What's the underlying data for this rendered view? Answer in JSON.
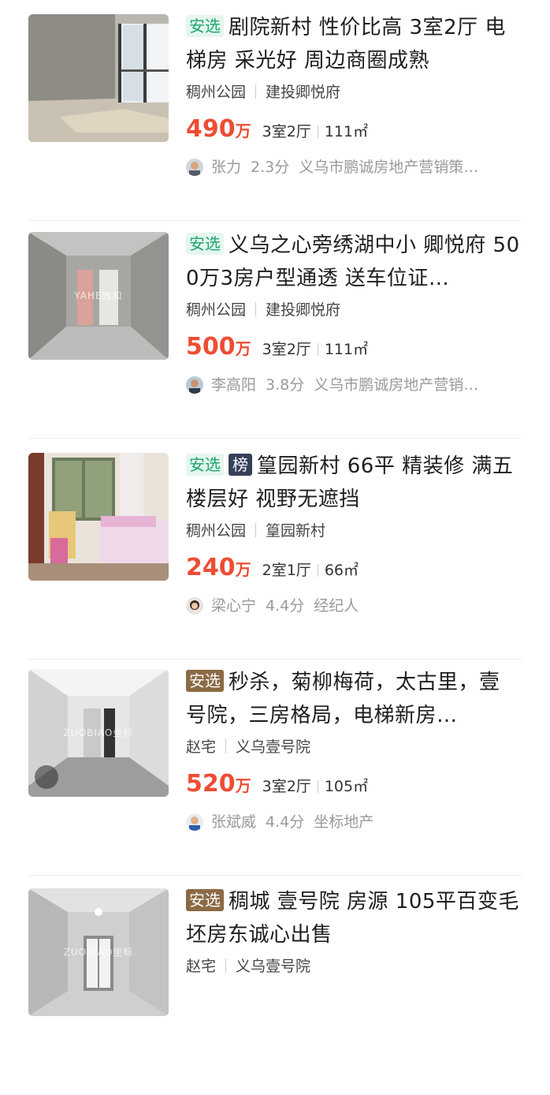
{
  "listings": [
    {
      "tags": [
        {
          "text": "安选",
          "style": "anxuan-green"
        }
      ],
      "title": "剧院新村 性价比高 3室2厅 电梯房 采光好 周边商圈成熟",
      "district": "稠州公园",
      "community": "建投卿悦府",
      "price": "490",
      "price_unit": "万",
      "layout": "3室2厅",
      "area": "111㎡",
      "agent": "张力",
      "score": "2.3分",
      "company": "义乌市鹏诚房地产营销策…",
      "image": "room-balcony"
    },
    {
      "tags": [
        {
          "text": "安选",
          "style": "anxuan-green"
        }
      ],
      "title": "义乌之心旁绣湖中小 卿悦府 500万3房户型通透 送车位证…",
      "district": "稠州公园",
      "community": "建投卿悦府",
      "price": "500",
      "price_unit": "万",
      "layout": "3室2厅",
      "area": "111㎡",
      "agent": "李高阳",
      "score": "3.8分",
      "company": "义乌市鹏诚房地产营销…",
      "image": "room-corridor",
      "watermark": "YAHE雅和"
    },
    {
      "tags": [
        {
          "text": "安选",
          "style": "anxuan-green"
        },
        {
          "text": "榜",
          "style": "bang"
        }
      ],
      "title": "篁园新村 66平 精装修 满五 楼层好 视野无遮挡",
      "district": "稠州公园",
      "community": "篁园新村",
      "price": "240",
      "price_unit": "万",
      "layout": "2室1厅",
      "area": "66㎡",
      "agent": "梁心宁",
      "score": "4.4分",
      "company": "经纪人",
      "image": "room-bedroom"
    },
    {
      "tags": [
        {
          "text": "安选",
          "style": "anxuan-brown"
        }
      ],
      "title": "秒杀，菊柳梅荷，太古里，壹号院，三房格局，电梯新房…",
      "district": "赵宅",
      "community": "义乌壹号院",
      "price": "520",
      "price_unit": "万",
      "layout": "3室2厅",
      "area": "105㎡",
      "agent": "张斌威",
      "score": "4.4分",
      "company": "坐标地产",
      "image": "room-white",
      "watermark": "ZUOBIAO坐标",
      "has_vr": true
    },
    {
      "tags": [
        {
          "text": "安选",
          "style": "anxuan-brown"
        }
      ],
      "title": "稠城 壹号院 房源 105平百变毛坯房东诚心出售",
      "district": "赵宅",
      "community": "义乌壹号院",
      "price": "",
      "price_unit": "",
      "layout": "",
      "area": "",
      "agent": "",
      "score": "",
      "company": "",
      "image": "room-white2",
      "watermark": "ZUOBIAO坐标"
    }
  ]
}
